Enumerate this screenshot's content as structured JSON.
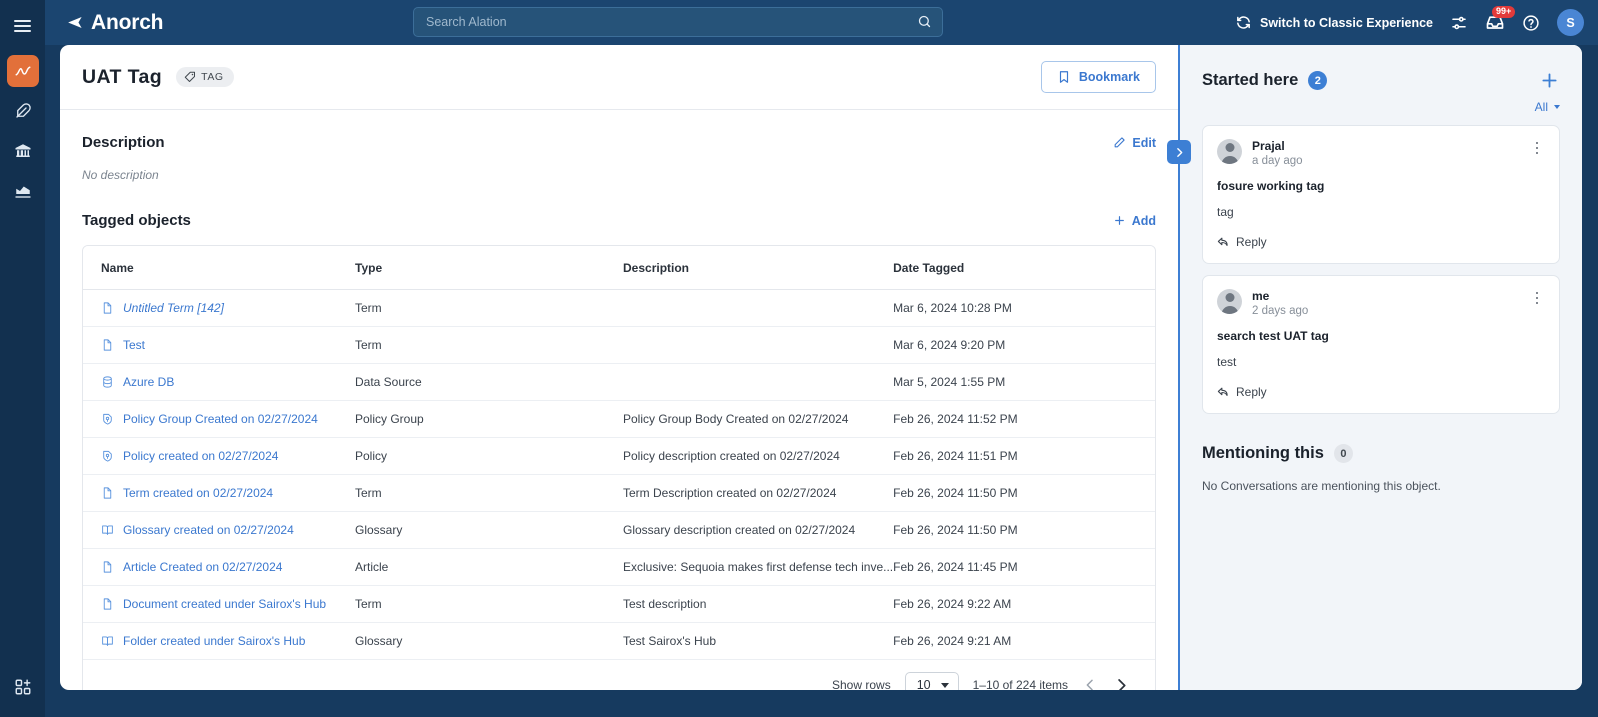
{
  "rail": {
    "menu_label": "menu",
    "items": [
      {
        "name": "analytics",
        "icon": "chart-scribble-icon",
        "active": true
      },
      {
        "name": "curation",
        "icon": "feather-icon",
        "active": false
      },
      {
        "name": "governance",
        "icon": "bank-icon",
        "active": false
      },
      {
        "name": "insights",
        "icon": "chart-icon",
        "active": false
      }
    ],
    "bottom": {
      "name": "apps",
      "icon": "grid-plus-icon"
    }
  },
  "topbar": {
    "brand": "Anorch",
    "search": {
      "placeholder": "Search Alation",
      "value": ""
    },
    "switch_experience": "Switch to Classic Experience",
    "settings_icon": "sliders-icon",
    "inbox_icon": "inbox-icon",
    "inbox_badge": "99+",
    "help_icon": "help-circle-icon",
    "avatar_initial": "S"
  },
  "page_header": {
    "title": "UAT Tag",
    "chip": {
      "icon": "tag-icon",
      "label": "TAG"
    },
    "bookmark": {
      "icon": "bookmark-icon",
      "label": "Bookmark"
    }
  },
  "description": {
    "section_title": "Description",
    "edit_label": "Edit",
    "edit_icon": "pencil-icon",
    "empty_text": "No description"
  },
  "tagged_objects": {
    "section_title": "Tagged objects",
    "add_label": "Add",
    "add_icon": "plus-icon",
    "columns": [
      "Name",
      "Type",
      "Description",
      "Date Tagged"
    ],
    "rows": [
      {
        "icon": "document-icon",
        "name": "Untitled Term [142]",
        "italic": true,
        "type": "Term",
        "description": "",
        "date": "Mar 6, 2024 10:28 PM"
      },
      {
        "icon": "document-icon",
        "name": "Test",
        "italic": false,
        "type": "Term",
        "description": "",
        "date": "Mar 6, 2024 9:20 PM"
      },
      {
        "icon": "database-icon",
        "name": "Azure DB",
        "italic": false,
        "type": "Data Source",
        "description": "",
        "date": "Mar 5, 2024 1:55 PM"
      },
      {
        "icon": "policy-icon",
        "name": "Policy Group Created on 02/27/2024",
        "italic": false,
        "type": "Policy Group",
        "description": "Policy Group Body Created on 02/27/2024",
        "date": "Feb 26, 2024 11:52 PM"
      },
      {
        "icon": "policy-icon",
        "name": "Policy created on 02/27/2024",
        "italic": false,
        "type": "Policy",
        "description": "Policy description created on 02/27/2024",
        "date": "Feb 26, 2024 11:51 PM"
      },
      {
        "icon": "document-icon",
        "name": "Term created on 02/27/2024",
        "italic": false,
        "type": "Term",
        "description": "Term Description created on 02/27/2024",
        "date": "Feb 26, 2024 11:50 PM"
      },
      {
        "icon": "book-icon",
        "name": "Glossary created on 02/27/2024",
        "italic": false,
        "type": "Glossary",
        "description": "Glossary description created on 02/27/2024",
        "date": "Feb 26, 2024 11:50 PM"
      },
      {
        "icon": "document-icon",
        "name": "Article Created on 02/27/2024",
        "italic": false,
        "type": "Article",
        "description": "Exclusive: Sequoia makes first defense tech inve...",
        "date": "Feb 26, 2024 11:45 PM"
      },
      {
        "icon": "document-icon",
        "name": "Document created under Sairox's Hub",
        "italic": false,
        "type": "Term",
        "description": "Test description",
        "date": "Feb 26, 2024 9:22 AM"
      },
      {
        "icon": "book-icon",
        "name": "Folder created under Sairox's Hub",
        "italic": false,
        "type": "Glossary",
        "description": "Test Sairox's Hub",
        "date": "Feb 26, 2024 9:21 AM"
      }
    ],
    "pagination": {
      "show_rows_label": "Show rows",
      "rows_value": "10",
      "range_text": "1–10 of 224 items",
      "prev_icon": "chevron-left-icon",
      "next_icon": "chevron-right-icon"
    }
  },
  "right_panel": {
    "collapse_icon": "chevron-right-icon",
    "started_here": {
      "title": "Started here",
      "count": "2",
      "add_icon": "plus-icon",
      "filter_label": "All"
    },
    "conversations": [
      {
        "author": "Prajal",
        "time": "a day ago",
        "title": "fosure working tag",
        "body": "tag",
        "reply_label": "Reply",
        "reply_icon": "reply-icon",
        "menu_icon": "kebab-menu-icon"
      },
      {
        "author": "me",
        "time": "2 days ago",
        "title": "search test UAT tag",
        "body": "test",
        "reply_label": "Reply",
        "reply_icon": "reply-icon",
        "menu_icon": "kebab-menu-icon"
      }
    ],
    "mentioning": {
      "title": "Mentioning this",
      "count": "0",
      "empty_text": "No Conversations are mentioning this object."
    }
  },
  "colors": {
    "brand_navy": "#1b4570",
    "rail_navy": "#12304f",
    "accent_orange": "#e2703a",
    "link_blue": "#3b78cf",
    "panel_blue": "#3d7fd4",
    "badge_red": "#e23a3a",
    "panel_bg": "#f2f5f9"
  }
}
